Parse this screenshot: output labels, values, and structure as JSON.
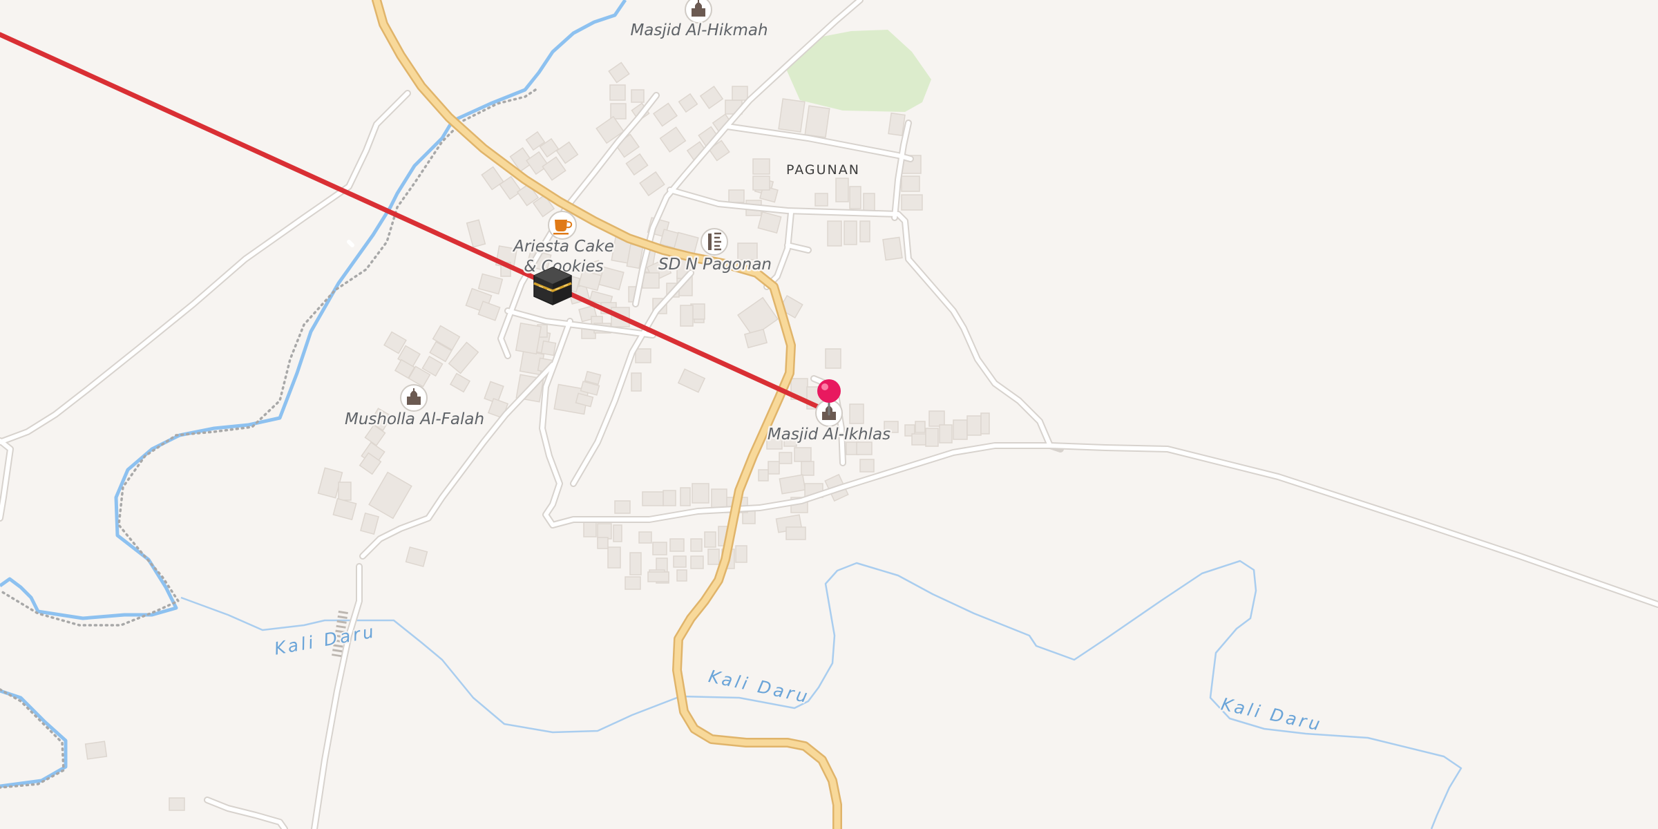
{
  "map": {
    "locality": "PAGUNAN",
    "pois": [
      {
        "id": "masjid-al-hikmah",
        "name": "Masjid Al-Hikmah",
        "icon": "mosque-icon"
      },
      {
        "id": "ariesta-cake",
        "name_line1": "Ariesta Cake",
        "name_line2": "& Cookies",
        "icon": "coffee-cup-icon"
      },
      {
        "id": "sd-n-pagonan",
        "name": "SD N Pagonan",
        "icon": "school-icon"
      },
      {
        "id": "musholla-al-falah",
        "name": "Musholla Al-Falah",
        "icon": "mosque-icon"
      },
      {
        "id": "masjid-al-ikhlas",
        "name": "Masjid Al-Ikhlas",
        "icon": "mosque-icon"
      }
    ],
    "rivers": [
      "Kali Daru",
      "Kali Daru",
      "Kali Daru"
    ],
    "markers": {
      "kaaba": {
        "icon": "kaaba-icon"
      },
      "location_pin": {
        "icon": "location-pin-icon",
        "color": "#e8195f"
      }
    },
    "qibla_line_color": "#d92f34",
    "main_road_color": "#f8d99a"
  }
}
